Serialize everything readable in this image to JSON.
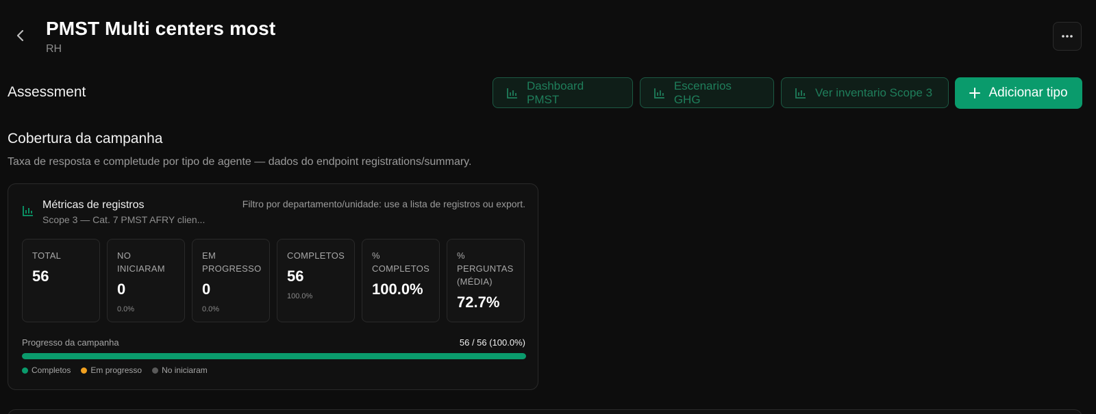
{
  "header": {
    "title": "PMST Multi centers most",
    "subtitle": "RH",
    "back_icon": "chevron-left-icon",
    "more_icon": "more-horizontal-icon"
  },
  "assessment": {
    "title": "Assessment",
    "actions": [
      {
        "label": "Dashboard PMST",
        "icon": "bar-chart-icon"
      },
      {
        "label": "Escenarios GHG",
        "icon": "bar-chart-icon"
      },
      {
        "label": "Ver inventario Scope 3",
        "icon": "bar-chart-icon"
      }
    ],
    "primary": {
      "label": "Adicionar tipo",
      "icon": "plus-icon"
    }
  },
  "campaign": {
    "title": "Cobertura da campanha",
    "description": "Taxa de resposta e completude por tipo de agente — dados do endpoint registrations/summary.",
    "card": {
      "title": "Métricas de registros",
      "subtitle": "Scope 3 — Cat. 7 PMST AFRY clien...",
      "note": "Filtro por departamento/unidade: use a lista de registros ou export.",
      "metrics": [
        {
          "label": "TOTAL",
          "value": "56",
          "pct": ""
        },
        {
          "label": "NO INICIARAM",
          "value": "0",
          "pct": "0.0%"
        },
        {
          "label": "EM PROGRESSO",
          "value": "0",
          "pct": "0.0%"
        },
        {
          "label": "COMPLETOS",
          "value": "56",
          "pct": "100.0%"
        },
        {
          "label": "% COMPLETOS",
          "value": "100.0%",
          "pct": ""
        },
        {
          "label": "% PERGUNTAS (MÉDIA)",
          "value": "72.7%",
          "pct": ""
        }
      ],
      "progress": {
        "label": "Progresso da campanha",
        "value_text": "56 / 56 (100.0%)",
        "fraction": 1.0
      },
      "legend": [
        {
          "label": "Completos",
          "color": "#0a9b6c"
        },
        {
          "label": "Em progresso",
          "color": "#f0a020"
        },
        {
          "label": "No iniciaram",
          "color": "#5a5a5a"
        }
      ]
    }
  },
  "colors": {
    "accent": "#0a9b6c",
    "background": "#0d0d0d"
  }
}
